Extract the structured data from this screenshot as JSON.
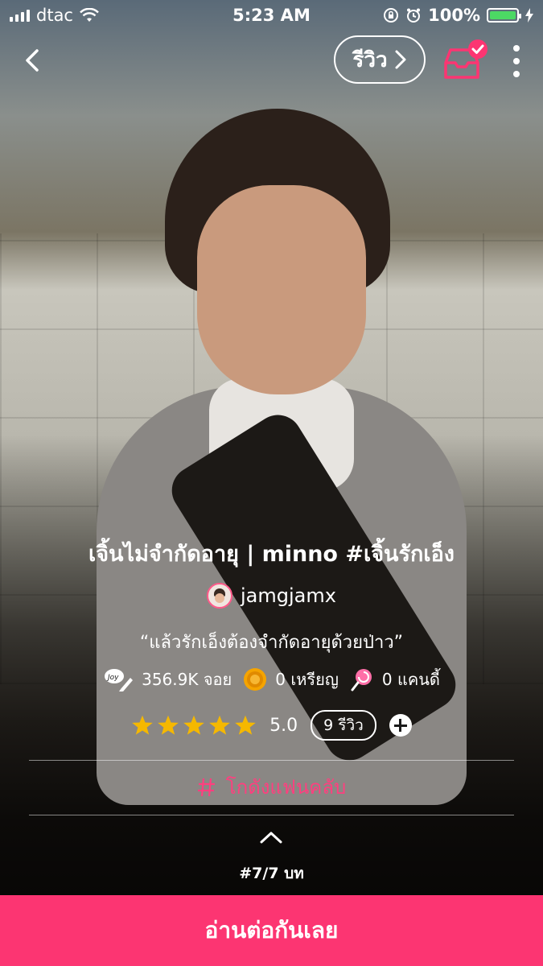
{
  "status_bar": {
    "carrier": "dtac",
    "time": "5:23 AM",
    "battery": "100%",
    "battery_color": "#4cd964"
  },
  "nav": {
    "back_icon": "chevron-left-icon",
    "review_label": "รีวิว",
    "inbox_icon": "inbox-check-icon",
    "more_icon": "more-vertical-icon"
  },
  "story": {
    "title": "เจิ้นไม่จำกัดอายุ | minno #เจิ้นรักเอ็ง",
    "author": "jamgjamx",
    "tagline": "“แล้วรักเอ็งต้องจำกัดอายุด้วยป่าว”",
    "views": "356.9K จอย",
    "coins": "0 เหรียญ",
    "candies": "0 แคนดี้",
    "rating": "5.0",
    "stars": 5,
    "review_count": "9 รีวิว",
    "fanclub_label": "โกดังแฟนคลับ",
    "chapter": "#7/7 บท"
  },
  "cta": {
    "read_label": "อ่านต่อกันเลย",
    "color": "#fc3572"
  },
  "colors": {
    "accent": "#fc3572",
    "fanclub": "#ff3f7f",
    "star": "#f5b800"
  }
}
